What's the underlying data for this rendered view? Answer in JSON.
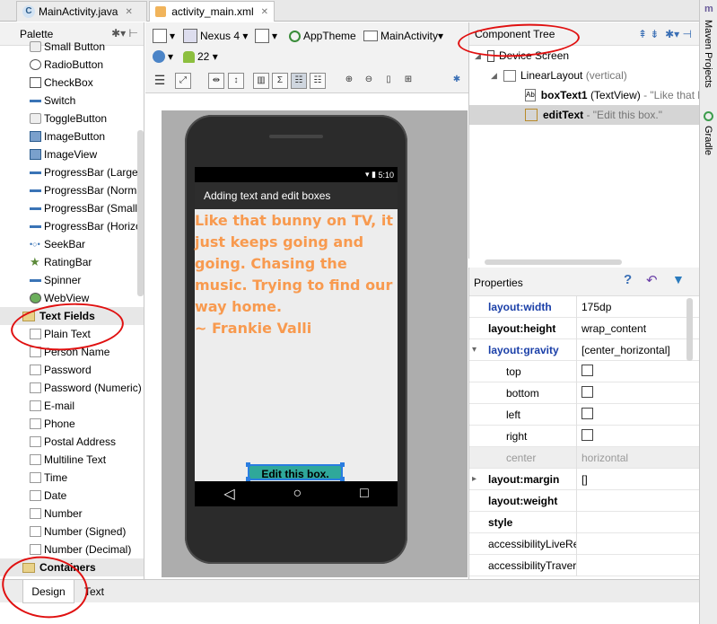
{
  "tabs": [
    {
      "label": "MainActivity.java",
      "icon": "java-class-icon"
    },
    {
      "label": "activity_main.xml",
      "icon": "xml-layout-icon",
      "active": true
    }
  ],
  "palette": {
    "title": "Palette",
    "items_top": [
      "Small Button",
      "RadioButton",
      "CheckBox",
      "Switch",
      "ToggleButton",
      "ImageButton",
      "ImageView",
      "ProgressBar (Large)",
      "ProgressBar (Normal)",
      "ProgressBar (Small)",
      "ProgressBar (Horizontal)",
      "SeekBar",
      "RatingBar",
      "Spinner",
      "WebView"
    ],
    "group_text": "Text Fields",
    "text_fields": [
      "Plain Text",
      "Person Name",
      "Password",
      "Password (Numeric)",
      "E-mail",
      "Phone",
      "Postal Address",
      "Multiline Text",
      "Time",
      "Date",
      "Number",
      "Number (Signed)",
      "Number (Decimal)"
    ],
    "group_containers": "Containers"
  },
  "toolbar": {
    "device": "Nexus 4",
    "theme": "AppTheme",
    "activity": "MainActivity",
    "api": "22"
  },
  "device_preview": {
    "time": "5:10",
    "app_title": "Adding text and edit boxes",
    "text_view": "Like that bunny on TV, it\njust keeps going and\ngoing. Chasing the\nmusic. Trying to find our\nway home.\n        ~ Frankie Valli",
    "edit_text": "Edit this box.",
    "nav": {
      "back": "◁",
      "home": "○",
      "recents": "□"
    }
  },
  "component_tree": {
    "title": "Component Tree",
    "root": "Device Screen",
    "layout": "LinearLayout",
    "layout_hint": "(vertical)",
    "nodes": [
      {
        "id": "boxText1",
        "type": "(TextView)",
        "hint": "- \"Like that bunny on TV, it just keeps going\""
      },
      {
        "id": "editText",
        "type": "",
        "hint": "- \"Edit this box.\"",
        "selected": true
      }
    ]
  },
  "properties": {
    "title": "Properties",
    "rows": [
      {
        "name": "layout:width",
        "value": "175dp",
        "style": "blue"
      },
      {
        "name": "layout:height",
        "value": "wrap_content",
        "style": "bold"
      },
      {
        "name": "layout:gravity",
        "value": "[center_horizontal]",
        "style": "blue",
        "expanded": true
      },
      {
        "name": "top",
        "value": "",
        "sub": true,
        "checkbox": true
      },
      {
        "name": "bottom",
        "value": "",
        "sub": true,
        "checkbox": true
      },
      {
        "name": "left",
        "value": "",
        "sub": true,
        "checkbox": true
      },
      {
        "name": "right",
        "value": "",
        "sub": true,
        "checkbox": true
      },
      {
        "name": "center",
        "value": "horizontal",
        "sub": true,
        "dim": true
      },
      {
        "name": "layout:margin",
        "value": "[]",
        "style": "bold",
        "collapsed": true
      },
      {
        "name": "layout:weight",
        "value": "",
        "style": "bold"
      },
      {
        "name": "style",
        "value": "",
        "style": "bold"
      },
      {
        "name": "accessibilityLiveRegion",
        "value": ""
      },
      {
        "name": "accessibilityTraversalAfter",
        "value": ""
      }
    ]
  },
  "side_panels": [
    "Maven Projects",
    "Gradle"
  ],
  "bottom_tabs": {
    "design": "Design",
    "text": "Text"
  },
  "colors": {
    "highlight_text": "#f89a4f",
    "annotation": "#e01010",
    "selected_edit": "#2fa89a"
  }
}
